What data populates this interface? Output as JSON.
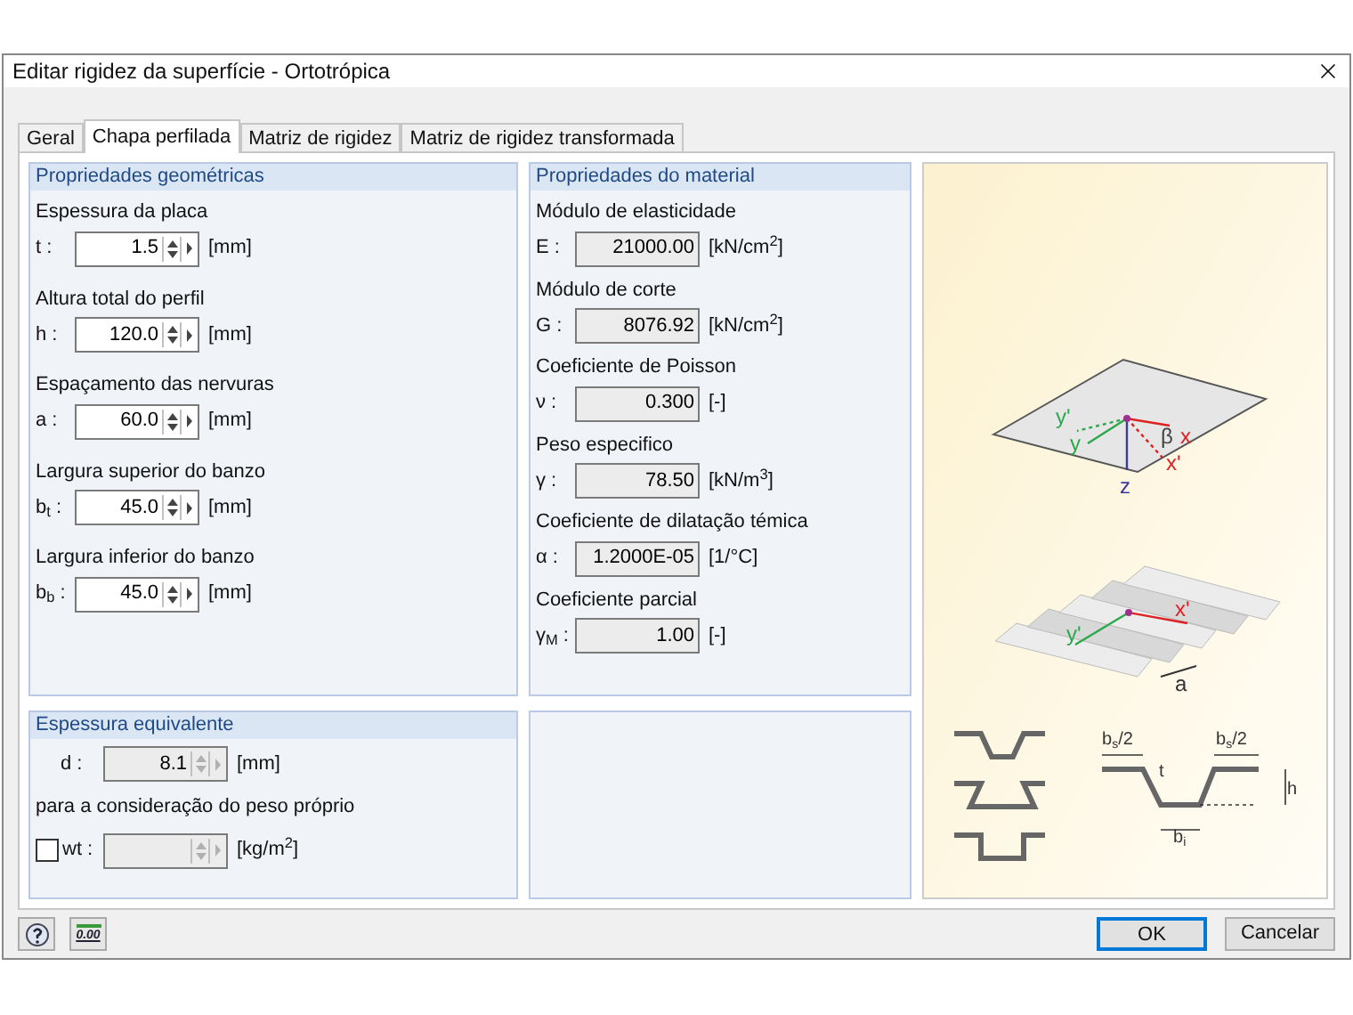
{
  "window": {
    "title": "Editar rigidez da superfície - Ortotrópica"
  },
  "tabs": [
    {
      "label": "Geral",
      "selected": false
    },
    {
      "label": "Chapa perfilada",
      "selected": true
    },
    {
      "label": "Matriz de rigidez",
      "selected": false
    },
    {
      "label": "Matriz de rigidez transformada",
      "selected": false
    }
  ],
  "geometry": {
    "title": "Propriedades geométricas",
    "fields": [
      {
        "label": "Espessura da placa",
        "symbol": "t :",
        "value": "1.5",
        "unit": "[mm]",
        "disabled": false
      },
      {
        "label": "Altura total do perfil",
        "symbol": "h :",
        "value": "120.0",
        "unit": "[mm]",
        "disabled": false
      },
      {
        "label": "Espaçamento das nervuras",
        "symbol": "a :",
        "value": "60.0",
        "unit": "[mm]",
        "disabled": false
      },
      {
        "label": "Largura superior do banzo",
        "symbol": "b$_{t}$ :",
        "value": "45.0",
        "unit": "[mm]",
        "disabled": false
      },
      {
        "label": "Largura inferior do banzo",
        "symbol": "b$_{b}$ :",
        "value": "45.0",
        "unit": "[mm]",
        "disabled": false
      }
    ]
  },
  "material": {
    "title": "Propriedades do material",
    "fields": [
      {
        "label": "Módulo de elasticidade",
        "symbol": "E :",
        "value": "21000.00",
        "unit": "[kN/cm$^{2}$]",
        "disabled": true
      },
      {
        "label": "Módulo de corte",
        "symbol": "G :",
        "value": "8076.92",
        "unit": "[kN/cm$^{2}$]",
        "disabled": true
      },
      {
        "label": "Coeficiente de Poisson",
        "symbol": "ν :",
        "value": "0.300",
        "unit": "[-]",
        "disabled": true
      },
      {
        "label": "Peso especifico",
        "symbol": "γ :",
        "value": "78.50",
        "unit": "[kN/m$^{3}$]",
        "disabled": true
      },
      {
        "label": "Coeficiente de dilatação témica",
        "symbol": "α :",
        "value": "1.2000E-05",
        "unit": "[1/°C]",
        "disabled": true
      },
      {
        "label": "Coeficiente parcial",
        "symbol": "γ$_{M}$ :",
        "value": "1.00",
        "unit": "[-]",
        "disabled": true
      }
    ]
  },
  "equivalent": {
    "title": "Espessura equivalente",
    "thickness": {
      "symbol": "d :",
      "value": "8.1",
      "unit": "[mm]",
      "disabled": true
    },
    "note": "para a consideração do peso próprio",
    "weight": {
      "checked": false,
      "symbol": "wt :",
      "unit": "[kg/m$^{2}$]",
      "disabled": true
    }
  },
  "diagram": {
    "axes_labels": [
      "y'",
      "y",
      "β",
      "x",
      "x'",
      "z"
    ],
    "sheet_labels": [
      "x'",
      "y'",
      "a"
    ],
    "section_labels": [
      "b$_{s}$/2",
      "b$_{s}$/2",
      "t",
      "h",
      "b$_{i}$"
    ]
  },
  "footer": {
    "units_icon": "0.00",
    "buttons": [
      {
        "label": "OK",
        "default": true
      },
      {
        "label": "Cancelar",
        "default": false
      }
    ]
  }
}
